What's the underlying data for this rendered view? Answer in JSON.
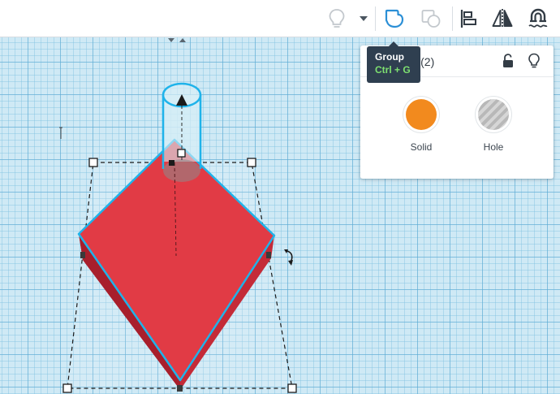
{
  "toolbar": {
    "buttons": [
      {
        "name": "lightbulb-icon",
        "enabled": false
      },
      {
        "name": "dropdown-caret-icon",
        "enabled": true
      },
      {
        "name": "group-icon",
        "enabled": true,
        "active": true
      },
      {
        "name": "ungroup-icon",
        "enabled": false
      },
      {
        "name": "align-icon",
        "enabled": true
      },
      {
        "name": "mirror-icon",
        "enabled": true
      },
      {
        "name": "cruise-magnet-icon",
        "enabled": true
      }
    ]
  },
  "tooltip": {
    "title": "Group",
    "shortcut": "Ctrl + G"
  },
  "inspector": {
    "title": "Shapes(2)",
    "title_visible_suffix": "hapes(2)",
    "options": [
      {
        "label": "Solid",
        "color": "#f28a1e"
      },
      {
        "label": "Hole",
        "color": "#b8b8b8"
      }
    ]
  },
  "colors": {
    "accent": "#2b8fd6",
    "shape_top": "#e13b45",
    "shape_side": "#b52331",
    "selection_outline": "#1fb3ea",
    "workplane": "#cfe9f5"
  }
}
